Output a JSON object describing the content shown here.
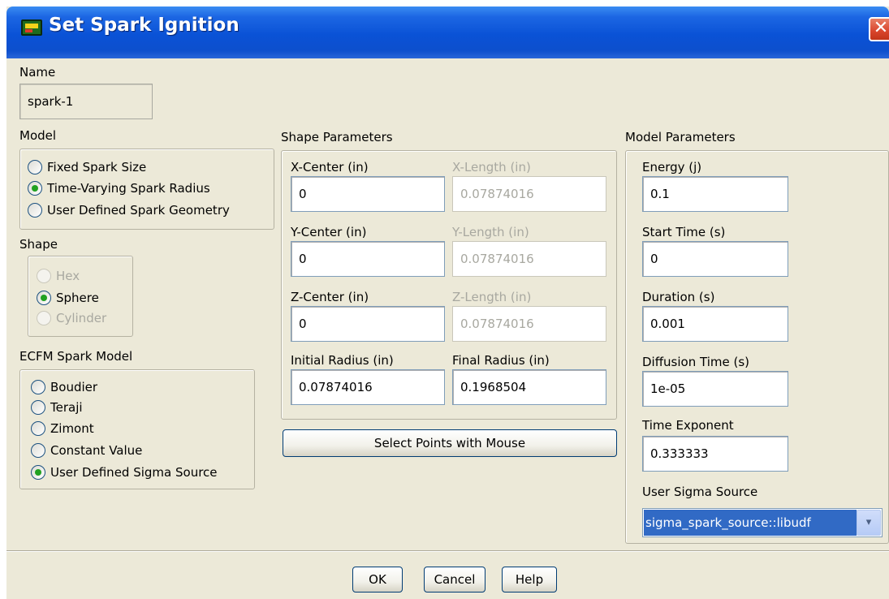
{
  "window": {
    "title": "Set Spark Ignition",
    "close_glyph": "✕"
  },
  "name": {
    "label": "Name",
    "value": "spark-1"
  },
  "model": {
    "label": "Model",
    "options": [
      {
        "label": "Fixed Spark Size",
        "checked": false
      },
      {
        "label": "Time-Varying Spark Radius",
        "checked": true
      },
      {
        "label": "User Defined Spark Geometry",
        "checked": false
      }
    ]
  },
  "shape": {
    "label": "Shape",
    "options": [
      {
        "label": "Hex",
        "checked": false,
        "disabled": true
      },
      {
        "label": "Sphere",
        "checked": true,
        "disabled": false
      },
      {
        "label": "Cylinder",
        "checked": false,
        "disabled": true
      }
    ]
  },
  "ecfm": {
    "label": "ECFM Spark Model",
    "options": [
      {
        "label": "Boudier",
        "checked": false
      },
      {
        "label": "Teraji",
        "checked": false
      },
      {
        "label": "Zimont",
        "checked": false
      },
      {
        "label": "Constant Value",
        "checked": false
      },
      {
        "label": "User Defined Sigma Source",
        "checked": true
      }
    ]
  },
  "shape_params": {
    "label": "Shape Parameters",
    "x_center": {
      "label": "X-Center (in)",
      "value": "0"
    },
    "x_length": {
      "label": "X-Length (in)",
      "value": "0.07874016"
    },
    "y_center": {
      "label": "Y-Center (in)",
      "value": "0"
    },
    "y_length": {
      "label": "Y-Length (in)",
      "value": "0.07874016"
    },
    "z_center": {
      "label": "Z-Center (in)",
      "value": "0"
    },
    "z_length": {
      "label": "Z-Length (in)",
      "value": "0.07874016"
    },
    "initial_radius": {
      "label": "Initial Radius (in)",
      "value": "0.07874016"
    },
    "final_radius": {
      "label": "Final Radius (in)",
      "value": "0.1968504"
    },
    "select_button": "Select Points with Mouse"
  },
  "model_params": {
    "label": "Model Parameters",
    "energy": {
      "label": "Energy (j)",
      "value": "0.1"
    },
    "start_time": {
      "label": "Start Time (s)",
      "value": "0"
    },
    "duration": {
      "label": "Duration (s)",
      "value": "0.001"
    },
    "diffusion_time": {
      "label": "Diffusion Time (s)",
      "value": "1e-05"
    },
    "time_exponent": {
      "label": "Time Exponent",
      "value": "0.333333"
    },
    "sigma_source": {
      "label": "User Sigma Source",
      "value": "sigma_spark_source::libudf",
      "arrow": "▾"
    }
  },
  "buttons": {
    "ok": "OK",
    "cancel": "Cancel",
    "help": "Help"
  }
}
